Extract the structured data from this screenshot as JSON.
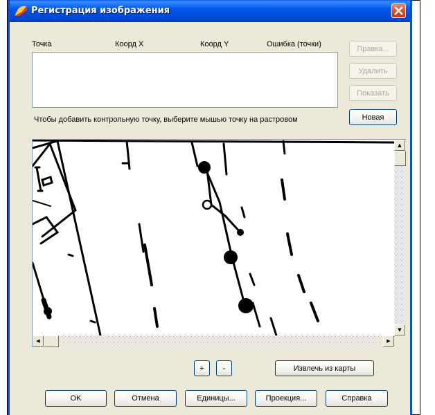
{
  "window": {
    "title": "Регистрация изображения"
  },
  "table": {
    "columns": [
      "Точка",
      "Коорд X",
      "Коорд Y",
      "Ошибка (точки)"
    ],
    "rows": []
  },
  "side_buttons": {
    "edit": "Правка...",
    "delete": "Удалить",
    "show": "Показать",
    "new": "Новая"
  },
  "hint": "Чтобы добавить контрольную точку, выберите мышью точку на растровом",
  "zoom": {
    "zoom_in": "+",
    "zoom_out": "-",
    "extract": "Извлечь из карты"
  },
  "footer": {
    "ok": "OK",
    "cancel": "Отмена",
    "units": "Единицы...",
    "projection": "Проекция...",
    "help": "Справка"
  },
  "colors": {
    "titlebar": "#0058e6",
    "close": "#d44a20",
    "dialog_bg": "#ece9d8"
  },
  "icons": {
    "app": "app-logo-icon",
    "close": "close-icon"
  }
}
